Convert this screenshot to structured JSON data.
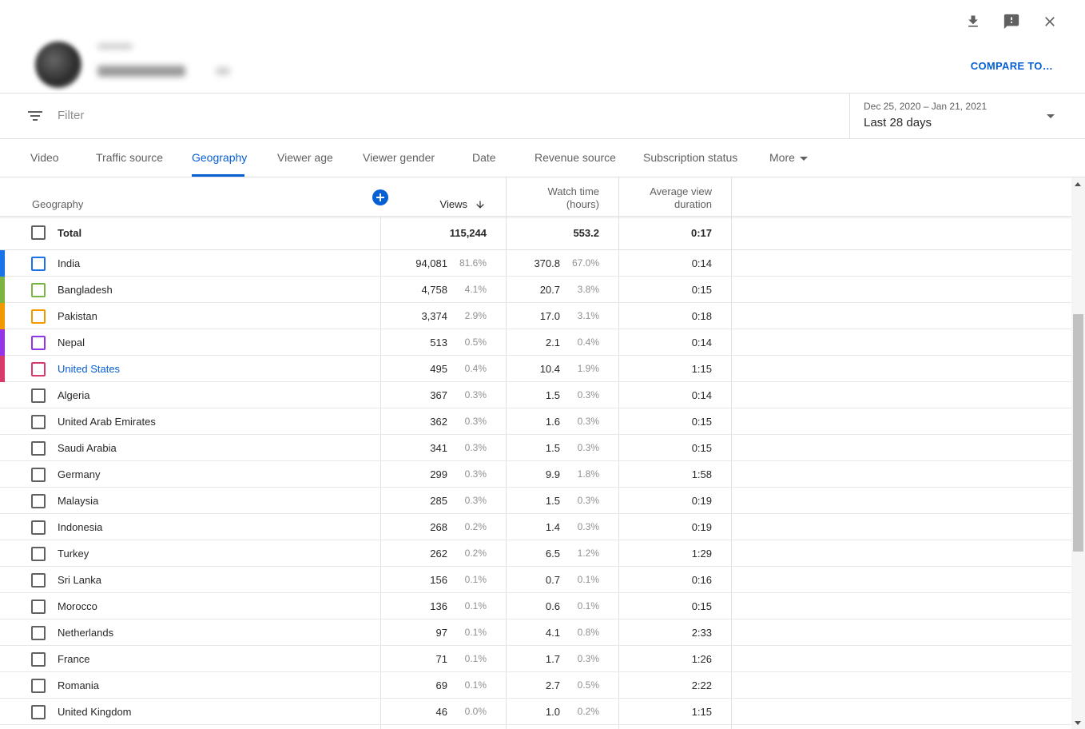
{
  "header": {
    "compare_label": "COMPARE TO…",
    "icons": [
      "download-icon",
      "feedback-icon",
      "close-icon"
    ]
  },
  "filter": {
    "placeholder": "Filter"
  },
  "date": {
    "range": "Dec 25, 2020 – Jan 21, 2021",
    "label": "Last 28 days"
  },
  "tabs": [
    {
      "label": "Video"
    },
    {
      "label": "Traffic source"
    },
    {
      "label": "Geography"
    },
    {
      "label": "Viewer age"
    },
    {
      "label": "Viewer gender"
    },
    {
      "label": "Date"
    },
    {
      "label": "Revenue source"
    },
    {
      "label": "Subscription status"
    },
    {
      "label": "More"
    }
  ],
  "active_tab": "Geography",
  "table": {
    "headers": {
      "geography": "Geography",
      "views": "Views",
      "watch_time_1": "Watch time",
      "watch_time_2": "(hours)",
      "avg_1": "Average view",
      "avg_2": "duration"
    },
    "total": {
      "name": "Total",
      "views": "115,244",
      "watch": "553.2",
      "avg": "0:17"
    },
    "rows": [
      {
        "name": "India",
        "views": "94,081",
        "views_pct": "81.6%",
        "watch": "370.8",
        "watch_pct": "67.0%",
        "avg": "0:14",
        "color": "#1a73e8"
      },
      {
        "name": "Bangladesh",
        "views": "4,758",
        "views_pct": "4.1%",
        "watch": "20.7",
        "watch_pct": "3.8%",
        "avg": "0:15",
        "color": "#7cb342"
      },
      {
        "name": "Pakistan",
        "views": "3,374",
        "views_pct": "2.9%",
        "watch": "17.0",
        "watch_pct": "3.1%",
        "avg": "0:18",
        "color": "#f29900"
      },
      {
        "name": "Nepal",
        "views": "513",
        "views_pct": "0.5%",
        "watch": "2.1",
        "watch_pct": "0.4%",
        "avg": "0:14",
        "color": "#9334e6"
      },
      {
        "name": "United States",
        "views": "495",
        "views_pct": "0.4%",
        "watch": "10.4",
        "watch_pct": "1.9%",
        "avg": "1:15",
        "color": "#d93a6a"
      },
      {
        "name": "Algeria",
        "views": "367",
        "views_pct": "0.3%",
        "watch": "1.5",
        "watch_pct": "0.3%",
        "avg": "0:14"
      },
      {
        "name": "United Arab Emirates",
        "views": "362",
        "views_pct": "0.3%",
        "watch": "1.6",
        "watch_pct": "0.3%",
        "avg": "0:15"
      },
      {
        "name": "Saudi Arabia",
        "views": "341",
        "views_pct": "0.3%",
        "watch": "1.5",
        "watch_pct": "0.3%",
        "avg": "0:15"
      },
      {
        "name": "Germany",
        "views": "299",
        "views_pct": "0.3%",
        "watch": "9.9",
        "watch_pct": "1.8%",
        "avg": "1:58"
      },
      {
        "name": "Malaysia",
        "views": "285",
        "views_pct": "0.3%",
        "watch": "1.5",
        "watch_pct": "0.3%",
        "avg": "0:19"
      },
      {
        "name": "Indonesia",
        "views": "268",
        "views_pct": "0.2%",
        "watch": "1.4",
        "watch_pct": "0.3%",
        "avg": "0:19"
      },
      {
        "name": "Turkey",
        "views": "262",
        "views_pct": "0.2%",
        "watch": "6.5",
        "watch_pct": "1.2%",
        "avg": "1:29"
      },
      {
        "name": "Sri Lanka",
        "views": "156",
        "views_pct": "0.1%",
        "watch": "0.7",
        "watch_pct": "0.1%",
        "avg": "0:16"
      },
      {
        "name": "Morocco",
        "views": "136",
        "views_pct": "0.1%",
        "watch": "0.6",
        "watch_pct": "0.1%",
        "avg": "0:15"
      },
      {
        "name": "Netherlands",
        "views": "97",
        "views_pct": "0.1%",
        "watch": "4.1",
        "watch_pct": "0.8%",
        "avg": "2:33"
      },
      {
        "name": "France",
        "views": "71",
        "views_pct": "0.1%",
        "watch": "1.7",
        "watch_pct": "0.3%",
        "avg": "1:26"
      },
      {
        "name": "Romania",
        "views": "69",
        "views_pct": "0.1%",
        "watch": "2.7",
        "watch_pct": "0.5%",
        "avg": "2:22"
      },
      {
        "name": "United Kingdom",
        "views": "46",
        "views_pct": "0.0%",
        "watch": "1.0",
        "watch_pct": "0.2%",
        "avg": "1:15"
      }
    ]
  },
  "colors": {
    "accent": "#065fd4"
  }
}
